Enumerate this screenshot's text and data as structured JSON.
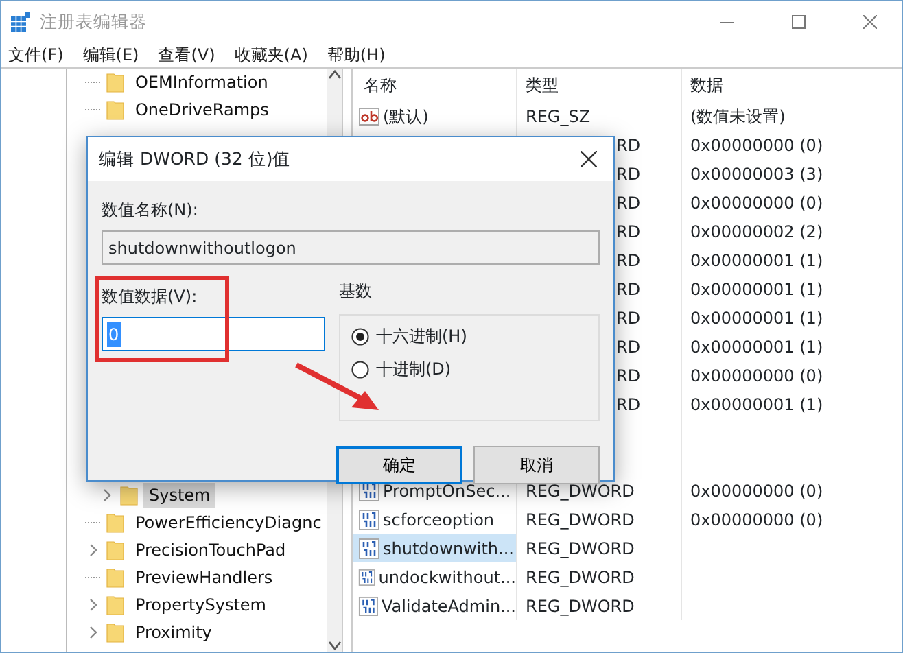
{
  "window": {
    "title": "注册表编辑器"
  },
  "menu": [
    "文件(F)",
    "编辑(E)",
    "查看(V)",
    "收藏夹(A)",
    "帮助(H)"
  ],
  "tree": {
    "top": [
      {
        "label": "OEMInformation",
        "expandable": false,
        "selected": false,
        "kind": "key"
      },
      {
        "label": "OneDriveRamps",
        "expandable": false,
        "selected": false,
        "kind": "key"
      }
    ],
    "bottom": [
      {
        "label": "System",
        "expandable": true,
        "selected": true,
        "kind": "subkey"
      },
      {
        "label": "PowerEfficiencyDiagnc",
        "expandable": false,
        "selected": false,
        "kind": "key"
      },
      {
        "label": "PrecisionTouchPad",
        "expandable": true,
        "selected": false,
        "kind": "key"
      },
      {
        "label": "PreviewHandlers",
        "expandable": false,
        "selected": false,
        "kind": "key"
      },
      {
        "label": "PropertySystem",
        "expandable": true,
        "selected": false,
        "kind": "key"
      },
      {
        "label": "Proximity",
        "expandable": true,
        "selected": false,
        "kind": "key"
      }
    ]
  },
  "list": {
    "columns": [
      "名称",
      "类型",
      "数据"
    ],
    "rows": [
      {
        "kind": "string",
        "name": "(默认)",
        "type": "REG_SZ",
        "data": "(数值未设置)",
        "selected": false
      },
      {
        "kind": "covered",
        "type": "RD",
        "data": "0x00000000 (0)"
      },
      {
        "kind": "covered",
        "type": "RD",
        "data": "0x00000003 (3)"
      },
      {
        "kind": "covered",
        "type": "RD",
        "data": "0x00000000 (0)"
      },
      {
        "kind": "covered",
        "type": "RD",
        "data": "0x00000002 (2)"
      },
      {
        "kind": "covered",
        "type": "RD",
        "data": "0x00000001 (1)"
      },
      {
        "kind": "covered",
        "type": "RD",
        "data": "0x00000001 (1)"
      },
      {
        "kind": "covered",
        "type": "RD",
        "data": "0x00000001 (1)"
      },
      {
        "kind": "covered",
        "type": "RD",
        "data": "0x00000001 (1)"
      },
      {
        "kind": "covered",
        "type": "RD",
        "data": "0x00000000 (0)"
      },
      {
        "kind": "covered",
        "type": "RD",
        "data": "0x00000001 (1)"
      },
      {
        "kind": "covered"
      },
      {
        "kind": "covered"
      },
      {
        "kind": "dword",
        "name": "PromptOnSec...",
        "type": "REG_DWORD",
        "data": "0x00000000 (0)",
        "selected": false
      },
      {
        "kind": "dword",
        "name": "scforceoption",
        "type": "REG_DWORD",
        "data": "0x00000000 (0)",
        "selected": false
      },
      {
        "kind": "dword",
        "name": "shutdownwith...",
        "type": "REG_DWORD",
        "selected": true
      },
      {
        "kind": "dword",
        "name": "undockwithout...",
        "type": "REG_DWORD",
        "selected": false
      },
      {
        "kind": "dword",
        "name": "ValidateAdmin...",
        "type": "REG_DWORD",
        "selected": false
      }
    ]
  },
  "dialog": {
    "title": "编辑 DWORD (32 位)值",
    "name_label": "数值名称(N):",
    "name_value": "shutdownwithoutlogon",
    "data_label": "数值数据(V):",
    "data_value": "0",
    "base_label": "基数",
    "radios": [
      {
        "label": "十六进制(H)",
        "selected": true
      },
      {
        "label": "十进制(D)",
        "selected": false
      }
    ],
    "buttons": [
      {
        "label": "确定",
        "focused": true
      },
      {
        "label": "取消",
        "focused": false
      }
    ]
  }
}
